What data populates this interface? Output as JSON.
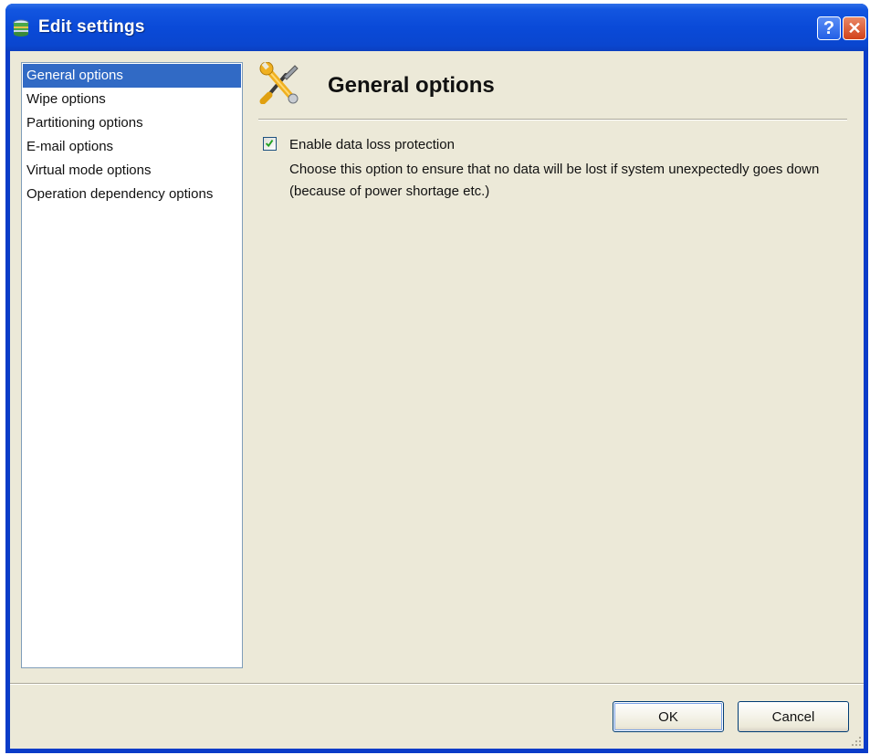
{
  "window": {
    "title": "Edit settings",
    "help_glyph": "?",
    "close_glyph": "✕"
  },
  "nav": {
    "items": [
      {
        "label": "General options",
        "selected": true
      },
      {
        "label": "Wipe options"
      },
      {
        "label": "Partitioning options"
      },
      {
        "label": "E-mail options"
      },
      {
        "label": "Virtual mode options"
      },
      {
        "label": "Operation dependency options"
      }
    ]
  },
  "content": {
    "title": "General options",
    "icon": "tools-icon",
    "option": {
      "label": "Enable data loss protection",
      "checked": true,
      "description": "Choose this option to ensure that no data will be lost if system unexpectedly goes down (because of power shortage etc.)"
    }
  },
  "buttons": {
    "ok_label": "OK",
    "cancel_label": "Cancel"
  },
  "colors": {
    "titlebar": "#0a4ad8",
    "selection": "#316ac5",
    "face": "#ece9d8"
  }
}
